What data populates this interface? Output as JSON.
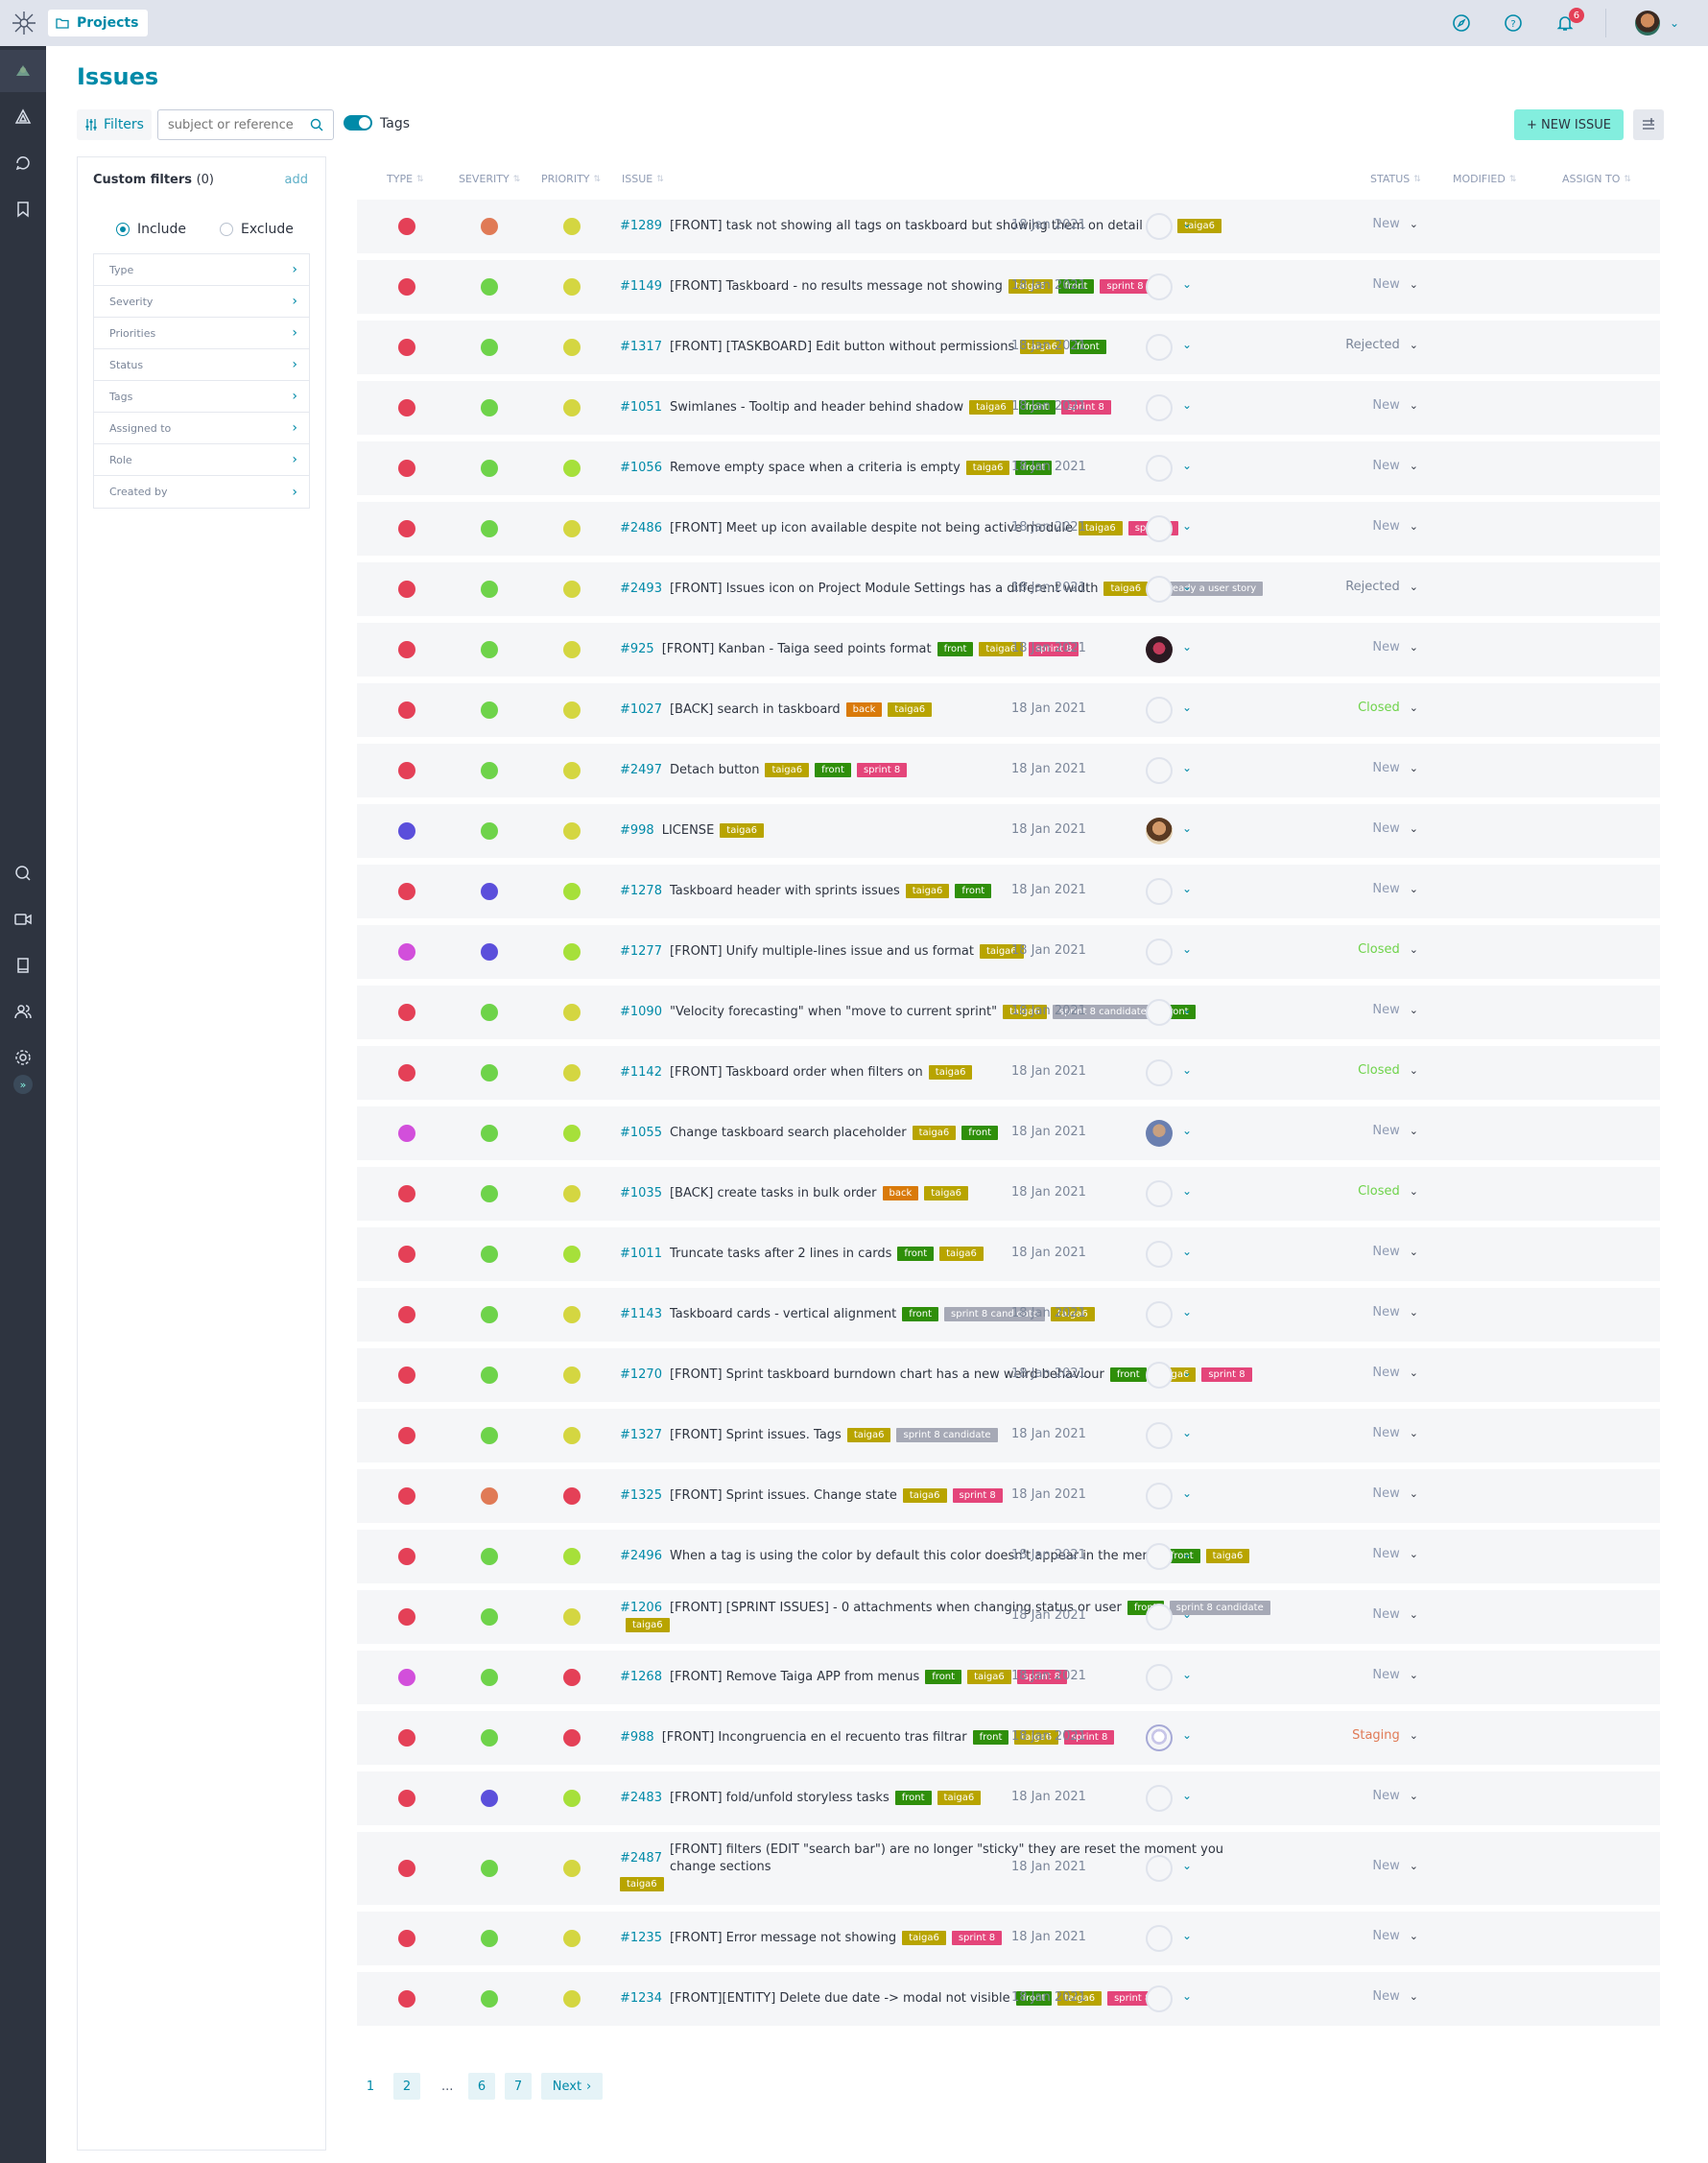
{
  "topbar": {
    "projects_label": "Projects",
    "notifications_count": "6"
  },
  "page": {
    "title": "Issues"
  },
  "toolbar": {
    "filters_label": "Filters",
    "search_placeholder": "subject or reference",
    "tags_label": "Tags",
    "new_issue_label": "+ NEW ISSUE"
  },
  "sidebar": {
    "custom_filters_label": "Custom filters",
    "custom_filters_count": "(0)",
    "add_label": "add",
    "include_label": "Include",
    "exclude_label": "Exclude",
    "filters": [
      "Type",
      "Severity",
      "Priorities",
      "Status",
      "Tags",
      "Assigned to",
      "Role",
      "Created by"
    ]
  },
  "table": {
    "headers": {
      "type": "TYPE",
      "severity": "SEVERITY",
      "priority": "PRIORITY",
      "issue": "ISSUE",
      "status": "STATUS",
      "modified": "MODIFIED",
      "assign": "ASSIGN TO"
    },
    "rows": [
      {
        "type": "#e44057",
        "severity": "#e07a56",
        "priority": "#d4d641",
        "ref": "#1289",
        "subject": "[FRONT] task not showing all tags on taskboard but showing them on detail vew",
        "tags": [
          {
            "t": "taiga6",
            "c": "#b8a400"
          }
        ],
        "status": "New",
        "status_color": "#8f9bb3",
        "modified": "18 Jan 2021",
        "assignee": "none"
      },
      {
        "type": "#e44057",
        "severity": "#6ed34a",
        "priority": "#d4d641",
        "ref": "#1149",
        "subject": "[FRONT] Taskboard - no results message not showing",
        "tags": [
          {
            "t": "taiga6",
            "c": "#b8a400"
          },
          {
            "t": "front",
            "c": "#2f8f0a"
          },
          {
            "t": "sprint 8",
            "c": "#e4457a"
          }
        ],
        "status": "New",
        "status_color": "#8f9bb3",
        "modified": "18 Jan 2021",
        "assignee": "none"
      },
      {
        "type": "#e44057",
        "severity": "#6ed34a",
        "priority": "#d4d641",
        "ref": "#1317",
        "subject": "[FRONT] [TASKBOARD] Edit button without permissions",
        "tags": [
          {
            "t": "taiga6",
            "c": "#b8a400"
          },
          {
            "t": "front",
            "c": "#2f8f0a"
          }
        ],
        "status": "Rejected",
        "status_color": "#7b8699",
        "modified": "18 Jan 2021",
        "assignee": "none"
      },
      {
        "type": "#e44057",
        "severity": "#6ed34a",
        "priority": "#d4d641",
        "ref": "#1051",
        "subject": "Swimlanes - Tooltip and header behind shadow",
        "tags": [
          {
            "t": "taiga6",
            "c": "#b8a400"
          },
          {
            "t": "front",
            "c": "#2f8f0a"
          },
          {
            "t": "sprint 8",
            "c": "#e4457a"
          }
        ],
        "status": "New",
        "status_color": "#8f9bb3",
        "modified": "18 Jan 2021",
        "assignee": "none"
      },
      {
        "type": "#e44057",
        "severity": "#6ed34a",
        "priority": "#a6e03a",
        "ref": "#1056",
        "subject": "Remove empty space when a criteria is empty",
        "tags": [
          {
            "t": "taiga6",
            "c": "#b8a400"
          },
          {
            "t": "front",
            "c": "#2f8f0a"
          }
        ],
        "status": "New",
        "status_color": "#8f9bb3",
        "modified": "18 Jan 2021",
        "assignee": "none"
      },
      {
        "type": "#e44057",
        "severity": "#6ed34a",
        "priority": "#d4d641",
        "ref": "#2486",
        "subject": "[FRONT] Meet up icon available despite not being active module",
        "tags": [
          {
            "t": "taiga6",
            "c": "#b8a400"
          },
          {
            "t": "sprint 8",
            "c": "#e4457a"
          }
        ],
        "status": "New",
        "status_color": "#8f9bb3",
        "modified": "18 Jan 2021",
        "assignee": "none"
      },
      {
        "type": "#e44057",
        "severity": "#6ed34a",
        "priority": "#d4d641",
        "ref": "#2493",
        "subject": "[FRONT] Issues icon on Project Module Settings has a different width",
        "tags": [
          {
            "t": "taiga6",
            "c": "#b8a400"
          },
          {
            "t": "already a user story",
            "c": "#a6a9b6"
          }
        ],
        "status": "Rejected",
        "status_color": "#7b8699",
        "modified": "18 Jan 2021",
        "assignee": "none"
      },
      {
        "type": "#e44057",
        "severity": "#6ed34a",
        "priority": "#d4d641",
        "ref": "#925",
        "subject": "[FRONT] Kanban - Taiga seed points format",
        "tags": [
          {
            "t": "front",
            "c": "#2f8f0a"
          },
          {
            "t": "taiga6",
            "c": "#b8a400"
          },
          {
            "t": "sprint 8",
            "c": "#e4457a"
          }
        ],
        "status": "New",
        "status_color": "#8f9bb3",
        "modified": "18 Jan 2021",
        "assignee": "person-a"
      },
      {
        "type": "#e44057",
        "severity": "#6ed34a",
        "priority": "#d4d641",
        "ref": "#1027",
        "subject": "[BACK] search in taskboard",
        "tags": [
          {
            "t": "back",
            "c": "#d97a0a"
          },
          {
            "t": "taiga6",
            "c": "#b8a400"
          }
        ],
        "status": "Closed",
        "status_color": "#6ed34a",
        "modified": "18 Jan 2021",
        "assignee": "none"
      },
      {
        "type": "#e44057",
        "severity": "#6ed34a",
        "priority": "#d4d641",
        "ref": "#2497",
        "subject": "Detach button",
        "tags": [
          {
            "t": "taiga6",
            "c": "#b8a400"
          },
          {
            "t": "front",
            "c": "#2f8f0a"
          },
          {
            "t": "sprint 8",
            "c": "#e4457a"
          }
        ],
        "status": "New",
        "status_color": "#8f9bb3",
        "modified": "18 Jan 2021",
        "assignee": "none"
      },
      {
        "type": "#5b4fdb",
        "severity": "#6ed34a",
        "priority": "#d4d641",
        "ref": "#998",
        "subject": "LICENSE",
        "tags": [
          {
            "t": "taiga6",
            "c": "#b8a400"
          }
        ],
        "status": "New",
        "status_color": "#8f9bb3",
        "modified": "18 Jan 2021",
        "assignee": "person-b"
      },
      {
        "type": "#e44057",
        "severity": "#5b4fdb",
        "priority": "#a6e03a",
        "ref": "#1278",
        "subject": "Taskboard header with sprints issues",
        "tags": [
          {
            "t": "taiga6",
            "c": "#b8a400"
          },
          {
            "t": "front",
            "c": "#2f8f0a"
          }
        ],
        "status": "New",
        "status_color": "#8f9bb3",
        "modified": "18 Jan 2021",
        "assignee": "none"
      },
      {
        "type": "#d24fdb",
        "severity": "#5b4fdb",
        "priority": "#a6e03a",
        "ref": "#1277",
        "subject": "[FRONT] Unify multiple-lines issue and us format",
        "tags": [
          {
            "t": "taiga6",
            "c": "#b8a400"
          }
        ],
        "status": "Closed",
        "status_color": "#6ed34a",
        "modified": "18 Jan 2021",
        "assignee": "none"
      },
      {
        "type": "#e44057",
        "severity": "#6ed34a",
        "priority": "#d4d641",
        "ref": "#1090",
        "subject": "\"Velocity forecasting\" when \"move to current sprint\"",
        "tags": [
          {
            "t": "taiga6",
            "c": "#b8a400"
          },
          {
            "t": "sprint 8 candidate",
            "c": "#a6a9b6"
          },
          {
            "t": "front",
            "c": "#2f8f0a"
          }
        ],
        "status": "New",
        "status_color": "#8f9bb3",
        "modified": "18 Jan 2021",
        "assignee": "none"
      },
      {
        "type": "#e44057",
        "severity": "#6ed34a",
        "priority": "#d4d641",
        "ref": "#1142",
        "subject": "[FRONT] Taskboard order when filters on",
        "tags": [
          {
            "t": "taiga6",
            "c": "#b8a400"
          }
        ],
        "status": "Closed",
        "status_color": "#6ed34a",
        "modified": "18 Jan 2021",
        "assignee": "none"
      },
      {
        "type": "#d24fdb",
        "severity": "#6ed34a",
        "priority": "#a6e03a",
        "ref": "#1055",
        "subject": "Change taskboard search placeholder",
        "tags": [
          {
            "t": "taiga6",
            "c": "#b8a400"
          },
          {
            "t": "front",
            "c": "#2f8f0a"
          }
        ],
        "status": "New",
        "status_color": "#8f9bb3",
        "modified": "18 Jan 2021",
        "assignee": "person-c"
      },
      {
        "type": "#e44057",
        "severity": "#6ed34a",
        "priority": "#d4d641",
        "ref": "#1035",
        "subject": "[BACK] create tasks in bulk order",
        "tags": [
          {
            "t": "back",
            "c": "#d97a0a"
          },
          {
            "t": "taiga6",
            "c": "#b8a400"
          }
        ],
        "status": "Closed",
        "status_color": "#6ed34a",
        "modified": "18 Jan 2021",
        "assignee": "none"
      },
      {
        "type": "#e44057",
        "severity": "#6ed34a",
        "priority": "#a6e03a",
        "ref": "#1011",
        "subject": "Truncate tasks after 2 lines in cards",
        "tags": [
          {
            "t": "front",
            "c": "#2f8f0a"
          },
          {
            "t": "taiga6",
            "c": "#b8a400"
          }
        ],
        "status": "New",
        "status_color": "#8f9bb3",
        "modified": "18 Jan 2021",
        "assignee": "none"
      },
      {
        "type": "#e44057",
        "severity": "#6ed34a",
        "priority": "#d4d641",
        "ref": "#1143",
        "subject": "Taskboard cards - vertical alignment",
        "tags": [
          {
            "t": "front",
            "c": "#2f8f0a"
          },
          {
            "t": "sprint 8 candidate",
            "c": "#a6a9b6"
          },
          {
            "t": "taiga6",
            "c": "#b8a400"
          }
        ],
        "status": "New",
        "status_color": "#8f9bb3",
        "modified": "18 Jan 2021",
        "assignee": "none"
      },
      {
        "type": "#e44057",
        "severity": "#6ed34a",
        "priority": "#d4d641",
        "ref": "#1270",
        "subject": "[FRONT] Sprint taskboard burndown chart has a new weird behaviour",
        "tags": [
          {
            "t": "front",
            "c": "#2f8f0a"
          },
          {
            "t": "taiga6",
            "c": "#b8a400"
          },
          {
            "t": "sprint 8",
            "c": "#e4457a"
          }
        ],
        "status": "New",
        "status_color": "#8f9bb3",
        "modified": "18 Jan 2021",
        "assignee": "none"
      },
      {
        "type": "#e44057",
        "severity": "#6ed34a",
        "priority": "#d4d641",
        "ref": "#1327",
        "subject": "[FRONT] Sprint issues. Tags",
        "tags": [
          {
            "t": "taiga6",
            "c": "#b8a400"
          },
          {
            "t": "sprint 8 candidate",
            "c": "#a6a9b6"
          }
        ],
        "status": "New",
        "status_color": "#8f9bb3",
        "modified": "18 Jan 2021",
        "assignee": "none"
      },
      {
        "type": "#e44057",
        "severity": "#e07a56",
        "priority": "#e44057",
        "ref": "#1325",
        "subject": "[FRONT] Sprint issues. Change state",
        "tags": [
          {
            "t": "taiga6",
            "c": "#b8a400"
          },
          {
            "t": "sprint 8",
            "c": "#e4457a"
          }
        ],
        "status": "New",
        "status_color": "#8f9bb3",
        "modified": "18 Jan 2021",
        "assignee": "none"
      },
      {
        "type": "#e44057",
        "severity": "#6ed34a",
        "priority": "#a6e03a",
        "ref": "#2496",
        "subject": "When a tag is using the color by default this color doesn't appear in the menu",
        "tags": [
          {
            "t": "front",
            "c": "#2f8f0a"
          },
          {
            "t": "taiga6",
            "c": "#b8a400"
          }
        ],
        "status": "New",
        "status_color": "#8f9bb3",
        "modified": "18 Jan 2021",
        "assignee": "none"
      },
      {
        "type": "#e44057",
        "severity": "#6ed34a",
        "priority": "#d4d641",
        "ref": "#1206",
        "subject": "[FRONT] [SPRINT ISSUES] - 0 attachments when changing status or user",
        "tags": [
          {
            "t": "front",
            "c": "#2f8f0a"
          },
          {
            "t": "sprint 8 candidate",
            "c": "#a6a9b6"
          },
          {
            "t": "taiga6",
            "c": "#b8a400"
          }
        ],
        "status": "New",
        "status_color": "#8f9bb3",
        "modified": "18 Jan 2021",
        "assignee": "none",
        "wrap": true
      },
      {
        "type": "#d24fdb",
        "severity": "#6ed34a",
        "priority": "#e44057",
        "ref": "#1268",
        "subject": "[FRONT] Remove Taiga APP from menus",
        "tags": [
          {
            "t": "front",
            "c": "#2f8f0a"
          },
          {
            "t": "taiga6",
            "c": "#b8a400"
          },
          {
            "t": "sprint 8",
            "c": "#e4457a"
          }
        ],
        "status": "New",
        "status_color": "#8f9bb3",
        "modified": "18 Jan 2021",
        "assignee": "none"
      },
      {
        "type": "#e44057",
        "severity": "#6ed34a",
        "priority": "#e44057",
        "ref": "#988",
        "subject": "[FRONT] Incongruencia en el recuento tras filtrar",
        "tags": [
          {
            "t": "front",
            "c": "#2f8f0a"
          },
          {
            "t": "taiga6",
            "c": "#b8a400"
          },
          {
            "t": "sprint 8",
            "c": "#e4457a"
          }
        ],
        "status": "Staging",
        "status_color": "#e07a56",
        "modified": "18 Jan 2021",
        "assignee": "generic"
      },
      {
        "type": "#e44057",
        "severity": "#5b4fdb",
        "priority": "#a6e03a",
        "ref": "#2483",
        "subject": "[FRONT] fold/unfold storyless tasks",
        "tags": [
          {
            "t": "front",
            "c": "#2f8f0a"
          },
          {
            "t": "taiga6",
            "c": "#b8a400"
          }
        ],
        "status": "New",
        "status_color": "#8f9bb3",
        "modified": "18 Jan 2021",
        "assignee": "none"
      },
      {
        "type": "#e44057",
        "severity": "#6ed34a",
        "priority": "#d4d641",
        "ref": "#2487",
        "subject": "[FRONT] filters (EDIT \"search bar\") are no longer \"sticky\" they are reset the moment you change sections",
        "tags": [
          {
            "t": "taiga6",
            "c": "#b8a400"
          }
        ],
        "status": "New",
        "status_color": "#8f9bb3",
        "modified": "18 Jan 2021",
        "assignee": "none",
        "tall": true
      },
      {
        "type": "#e44057",
        "severity": "#6ed34a",
        "priority": "#d4d641",
        "ref": "#1235",
        "subject": "[FRONT] Error message not showing",
        "tags": [
          {
            "t": "taiga6",
            "c": "#b8a400"
          },
          {
            "t": "sprint 8",
            "c": "#e4457a"
          }
        ],
        "status": "New",
        "status_color": "#8f9bb3",
        "modified": "18 Jan 2021",
        "assignee": "none"
      },
      {
        "type": "#e44057",
        "severity": "#6ed34a",
        "priority": "#d4d641",
        "ref": "#1234",
        "subject": "[FRONT][ENTITY] Delete due date -> modal not visible",
        "tags": [
          {
            "t": "front",
            "c": "#2f8f0a"
          },
          {
            "t": "taiga6",
            "c": "#b8a400"
          },
          {
            "t": "sprint 8",
            "c": "#e4457a"
          }
        ],
        "status": "New",
        "status_color": "#8f9bb3",
        "modified": "18 Jan 2021",
        "assignee": "none"
      }
    ]
  },
  "pagination": {
    "pages": [
      "1",
      "2",
      "...",
      "6",
      "7"
    ],
    "next_label": "Next"
  }
}
